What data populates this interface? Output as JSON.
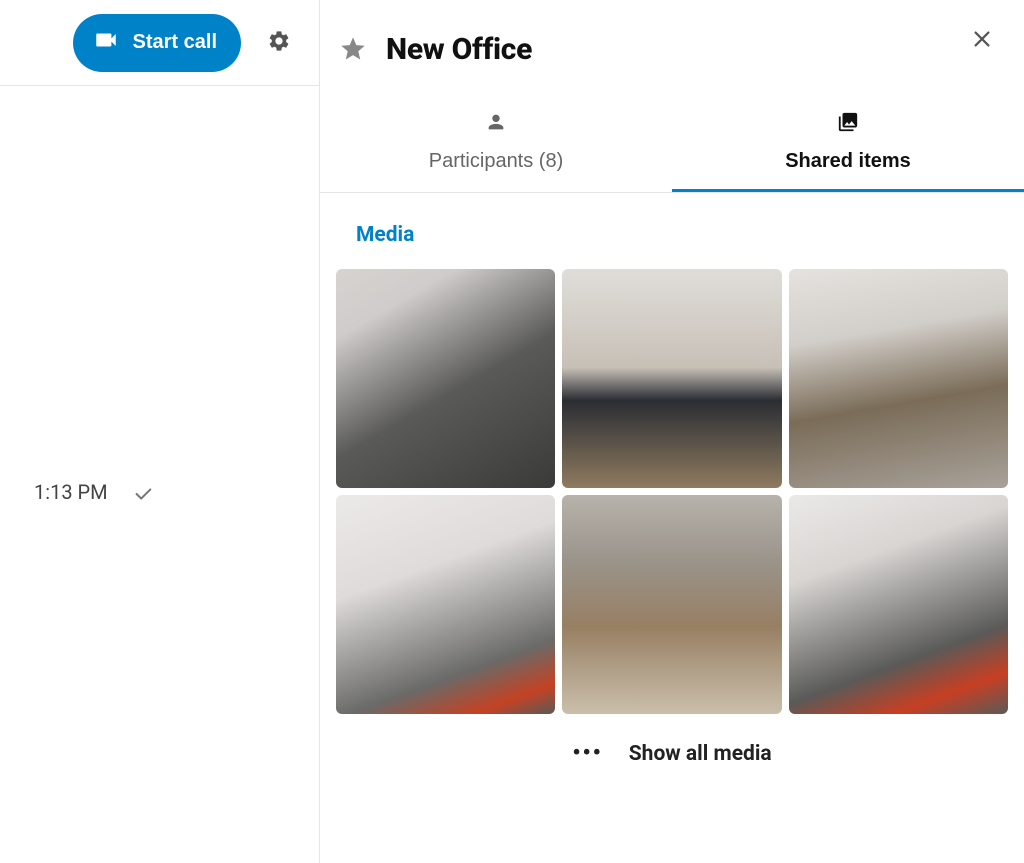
{
  "left": {
    "start_call_label": "Start call",
    "timestamp": "1:13 PM"
  },
  "panel": {
    "title": "New Office"
  },
  "tabs": {
    "participants": {
      "label": "Participants (8)"
    },
    "shared": {
      "label": "Shared items"
    }
  },
  "media": {
    "section_title": "Media",
    "show_all": "Show all media",
    "items": [
      "office-open-space",
      "pendant-lamps-table",
      "hallway-boxes",
      "desks-red-chairs",
      "courtyard-rubble",
      "workstations-red-chairs"
    ]
  }
}
